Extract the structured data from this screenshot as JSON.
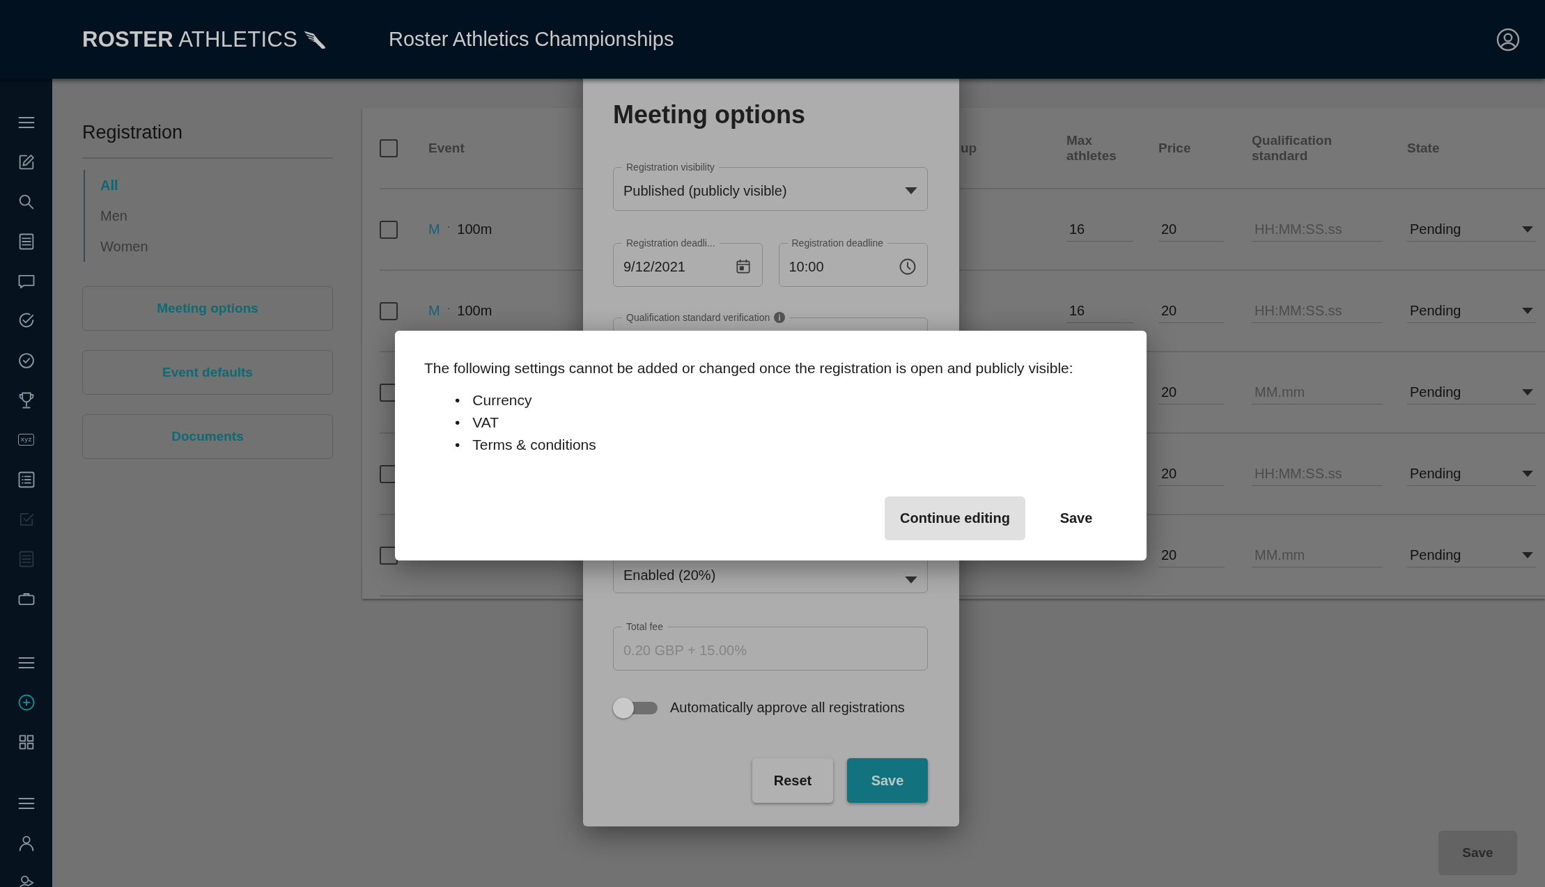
{
  "header": {
    "logo": "**ROSTER** ATHLETICS",
    "title": "Roster Athletics Championships"
  },
  "rail": [
    {
      "items": [
        {
          "kind": "menu",
          "disabled": false,
          "selected": false
        },
        {
          "kind": "edit",
          "disabled": false,
          "selected": false
        },
        {
          "kind": "search",
          "disabled": false,
          "selected": false
        },
        {
          "kind": "document",
          "disabled": false,
          "selected": false
        },
        {
          "kind": "chat",
          "disabled": false,
          "selected": false
        },
        {
          "kind": "check-circle",
          "disabled": false,
          "selected": false
        },
        {
          "kind": "check-circle-small",
          "disabled": false,
          "selected": false
        },
        {
          "kind": "trophy",
          "disabled": false,
          "selected": false
        },
        {
          "kind": "text-badge",
          "text": "xyz",
          "disabled": false,
          "selected": false
        },
        {
          "kind": "bullet-list",
          "disabled": false,
          "selected": false
        },
        {
          "kind": "checkbox",
          "disabled": true,
          "selected": false
        },
        {
          "kind": "document",
          "disabled": true,
          "selected": false
        },
        {
          "kind": "briefcase",
          "disabled": false,
          "selected": false
        }
      ]
    },
    {
      "items": [
        {
          "kind": "menu",
          "disabled": false,
          "selected": false
        },
        {
          "kind": "plus-circle",
          "disabled": false,
          "selected": true
        },
        {
          "kind": "grid",
          "disabled": false,
          "selected": false
        }
      ]
    },
    {
      "items": [
        {
          "kind": "menu",
          "disabled": false,
          "selected": false
        },
        {
          "kind": "person",
          "disabled": false,
          "selected": false
        },
        {
          "kind": "person-arrow",
          "disabled": false,
          "selected": false
        }
      ]
    }
  ],
  "sidebar": {
    "title": "Registration",
    "filters": [
      {
        "label": "All",
        "selected": true
      },
      {
        "label": "Men",
        "selected": false
      },
      {
        "label": "Women",
        "selected": false
      }
    ],
    "buttons": [
      "Meeting options",
      "Event defaults",
      "Documents"
    ]
  },
  "table": {
    "select_all_checked": false,
    "columns": [
      "Event",
      "up",
      "Max athletes",
      "Price",
      "Qualification standard",
      "State"
    ],
    "rows": [
      {
        "checked": false,
        "gender": "M",
        "separator": "·",
        "event": "100m",
        "max_athletes": "16",
        "price": "20",
        "qualification_placeholder": "HH:MM:SS.ss",
        "state": "Pending"
      },
      {
        "checked": false,
        "gender": "M",
        "separator": "·",
        "event": "100m",
        "max_athletes": "16",
        "price": "20",
        "qualification_placeholder": "HH:MM:SS.ss",
        "state": "Pending"
      },
      {
        "checked": false,
        "price": "20",
        "qualification_placeholder": "MM.mm",
        "state": "Pending"
      },
      {
        "checked": false,
        "price": "20",
        "qualification_placeholder": "HH:MM:SS.ss",
        "state": "Pending"
      },
      {
        "checked": false,
        "price": "20",
        "qualification_placeholder": "MM.mm",
        "state": "Pending"
      }
    ]
  },
  "save_button": {
    "label": "Save",
    "disabled": true
  },
  "meeting_dialog": {
    "title": "Meeting options",
    "visibility": {
      "label": "Registration visibility",
      "value": "Published (publicly visible)"
    },
    "deadline_date": {
      "label": "Registration deadli...",
      "value": "9/12/2021"
    },
    "deadline_time": {
      "label": "Registration deadline",
      "value": "10:00"
    },
    "qualification_verification": {
      "label": "Qualification standard verification"
    },
    "vat": {
      "value": "Enabled (20%)"
    },
    "total_fee": {
      "label": "Total fee",
      "value": "0.20 GBP + 15.00%",
      "disabled": true
    },
    "auto_approve": {
      "label": "Automatically approve all registrations",
      "on": false
    },
    "buttons": [
      {
        "label": "Reset",
        "kind": "secondary"
      },
      {
        "label": "Save",
        "kind": "primary"
      }
    ]
  },
  "confirm_dialog": {
    "message": "The following settings cannot be added or changed once the registration is open and publicly visible:",
    "items": [
      {
        "bullet": "•",
        "label": "Currency"
      },
      {
        "bullet": "•",
        "label": "VAT"
      },
      {
        "bullet": "•",
        "label": "Terms & conditions"
      }
    ],
    "buttons": [
      {
        "label": "Continue editing",
        "kind": "filled"
      },
      {
        "label": "Save",
        "kind": "text"
      }
    ]
  }
}
